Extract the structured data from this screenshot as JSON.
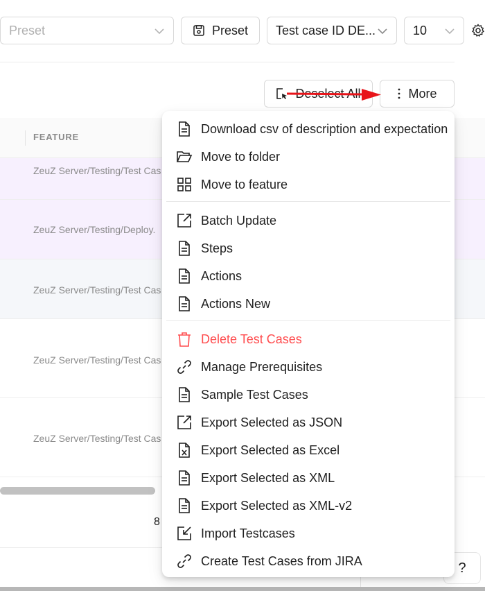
{
  "toolbar": {
    "preset_placeholder": "Preset",
    "preset_button_label": "Preset",
    "sort_select_value": "Test case ID DE...",
    "page_size_value": "10"
  },
  "actions": {
    "deselect_all_label": "Deselect All",
    "more_label": "More"
  },
  "table": {
    "columns": [
      "FEATURE"
    ],
    "rows": [
      "ZeuZ Server/Testing/Test Cas",
      "ZeuZ Server/Testing/Deploy.",
      "ZeuZ Server/Testing/Test Cas",
      "ZeuZ Server/Testing/Test Cas",
      "ZeuZ Server/Testing/Test Cas"
    ],
    "footer_count": "8"
  },
  "help_label": "?",
  "menu": {
    "items": [
      {
        "label": "Download csv of description and expectation",
        "icon": "file-icon"
      },
      {
        "label": "Move to folder",
        "icon": "folder-open-icon"
      },
      {
        "label": "Move to feature",
        "icon": "grid-icon"
      },
      {
        "label": "Batch Update",
        "icon": "export-icon"
      },
      {
        "label": "Steps",
        "icon": "file-icon"
      },
      {
        "label": "Actions",
        "icon": "file-icon"
      },
      {
        "label": "Actions New",
        "icon": "file-icon"
      },
      {
        "label": "Delete Test Cases",
        "icon": "trash-icon"
      },
      {
        "label": "Manage Prerequisites",
        "icon": "link-icon"
      },
      {
        "label": "Sample Test Cases",
        "icon": "file-icon"
      },
      {
        "label": "Export Selected as JSON",
        "icon": "export-icon"
      },
      {
        "label": "Export Selected as Excel",
        "icon": "file-excel-icon"
      },
      {
        "label": "Export Selected as XML",
        "icon": "file-icon"
      },
      {
        "label": "Export Selected as XML-v2",
        "icon": "file-icon"
      },
      {
        "label": "Import Testcases",
        "icon": "import-icon"
      },
      {
        "label": "Create Test Cases from JIRA",
        "icon": "link-icon"
      }
    ]
  },
  "colors": {
    "danger": "#ff4d4f",
    "selected_row": "#f7f0fe",
    "hover_row": "#f5f7fa",
    "annotation_arrow": "#e8141a"
  }
}
